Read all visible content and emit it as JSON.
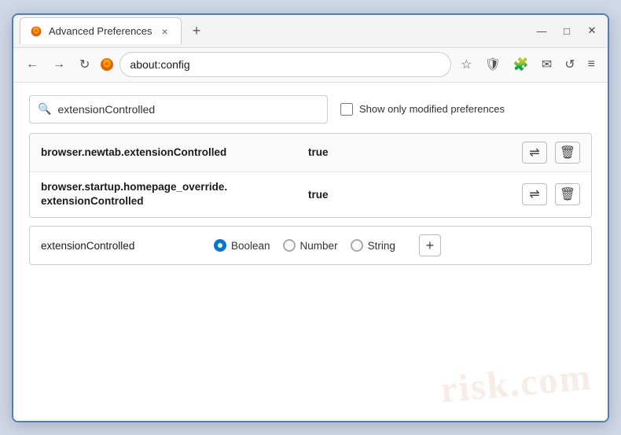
{
  "browser": {
    "tab_title": "Advanced Preferences",
    "tab_close_label": "×",
    "new_tab_label": "+",
    "win_minimize": "—",
    "win_maximize": "□",
    "win_close": "✕"
  },
  "navbar": {
    "back_label": "←",
    "forward_label": "→",
    "refresh_label": "↻",
    "firefox_label": "Firefox",
    "address": "about:config",
    "star_icon": "☆",
    "shield_icon": "🛡",
    "ext_icon": "🧩",
    "account_icon": "✉",
    "history_icon": "↺",
    "menu_icon": "≡"
  },
  "search": {
    "placeholder": "extensionControlled",
    "checkbox_label": "Show only modified preferences"
  },
  "preferences": [
    {
      "name": "browser.newtab.extensionControlled",
      "value": "true"
    },
    {
      "name_line1": "browser.startup.homepage_override.",
      "name_line2": "extensionControlled",
      "value": "true"
    }
  ],
  "add_row": {
    "name": "extensionControlled",
    "radio_options": [
      {
        "id": "boolean",
        "label": "Boolean",
        "selected": true
      },
      {
        "id": "number",
        "label": "Number",
        "selected": false
      },
      {
        "id": "string",
        "label": "String",
        "selected": false
      }
    ],
    "add_button_label": "+"
  },
  "watermark": "risk.com",
  "icons": {
    "reset_icon": "⇌",
    "delete_icon": "🗑"
  }
}
